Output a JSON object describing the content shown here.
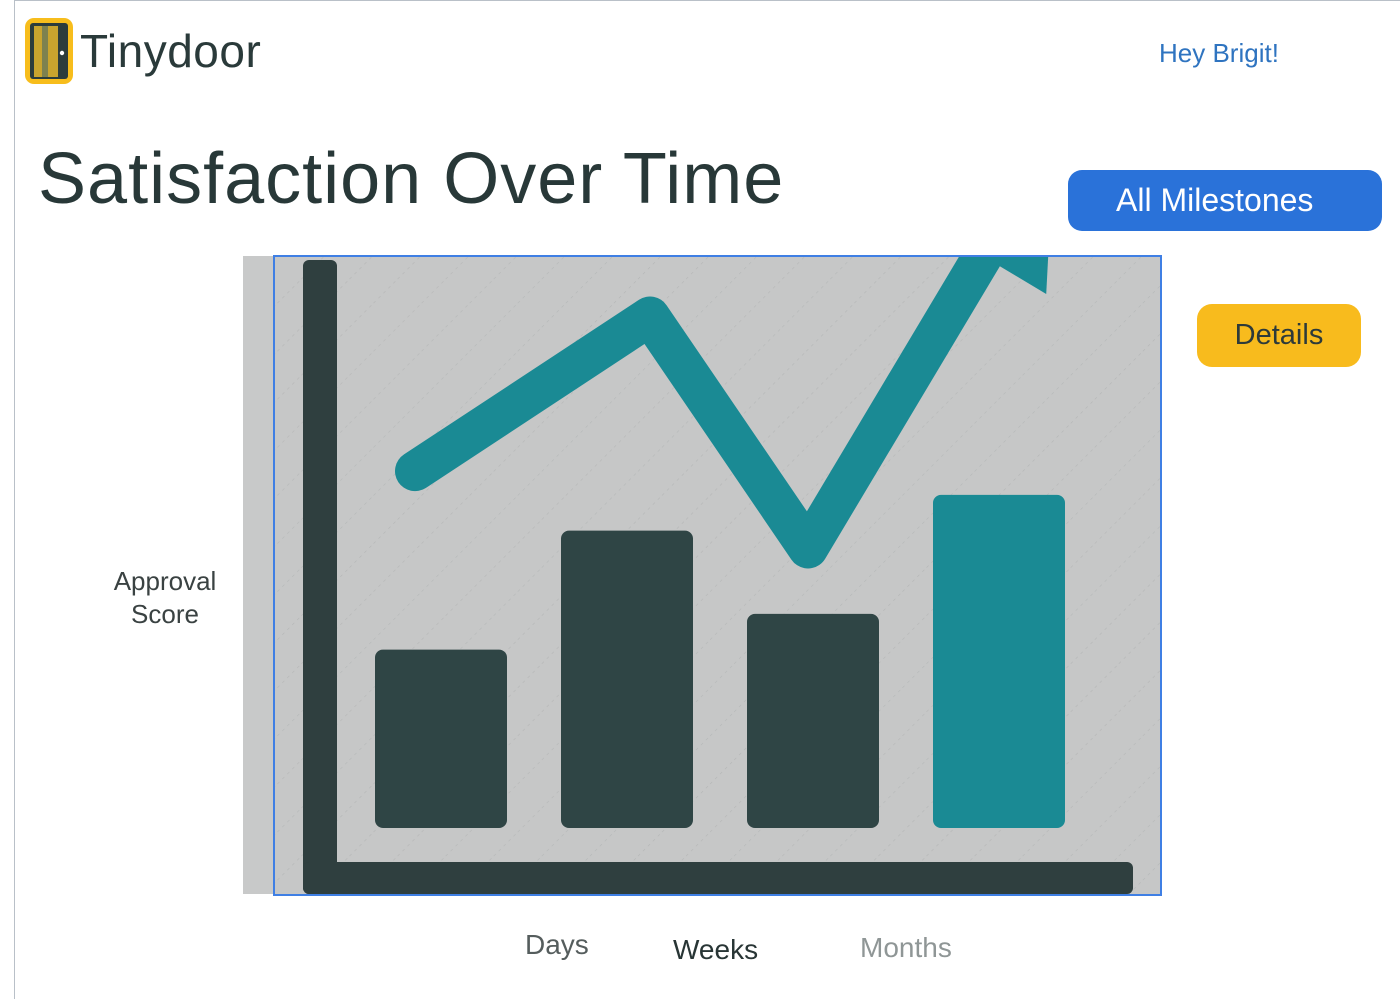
{
  "header": {
    "app_name": "Tinydoor",
    "greeting": "Hey Brigit!"
  },
  "page": {
    "title": "Satisfaction Over Time"
  },
  "actions": {
    "all_milestones_label": "All Milestones",
    "details_label": "Details"
  },
  "chart": {
    "ylabel_line1": "Approval",
    "ylabel_line2": "Score",
    "tabs": [
      "Days",
      "Weeks",
      "Months"
    ],
    "selected_tab": "Weeks"
  },
  "chart_data": {
    "type": "bar",
    "categories": [
      "",
      "",
      "",
      ""
    ],
    "values": [
      30,
      50,
      36,
      56
    ],
    "trend_line": [
      60,
      86,
      47,
      94
    ],
    "ylabel": "Approval Score",
    "xlabel": "",
    "ylim": [
      0,
      96
    ],
    "grid": false,
    "colors": {
      "bar": "#2f4545",
      "highlight_bar": "#1a8a94",
      "trend": "#1a8a94",
      "axis": "#2f3f3f",
      "background": "#c6c7c7"
    }
  },
  "colors": {
    "primary_button": "#2a72d9",
    "secondary_button": "#f8bb1d",
    "link": "#2f74c0",
    "title": "#283838"
  },
  "icons": {
    "logo": "door-icon"
  }
}
